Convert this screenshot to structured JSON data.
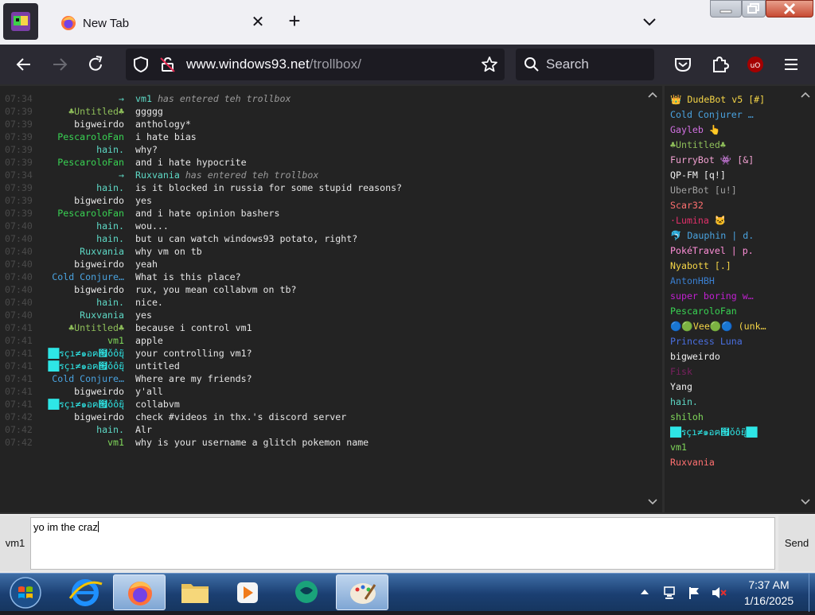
{
  "browser": {
    "tab_title": "New Tab",
    "url_host": "www.windows93.net",
    "url_path": "/trollbox/",
    "search_placeholder": "Search"
  },
  "chat": {
    "messages": [
      {
        "time": "07:34",
        "nick": "→",
        "nick_color": "#5ed9c6",
        "text": "has entered teh trollbox",
        "system_nick": "vm1"
      },
      {
        "time": "07:39",
        "nick": "♣Untitled♣",
        "nick_color": "#8fbf5a",
        "text": "ggggg"
      },
      {
        "time": "07:39",
        "nick": "bigweirdo",
        "nick_color": "#e6e6e6",
        "text": "anthology*"
      },
      {
        "time": "07:39",
        "nick": "PescaroloFan",
        "nick_color": "#39d353",
        "text": "i hate bias"
      },
      {
        "time": "07:39",
        "nick": "hain.",
        "nick_color": "#5ed9c6",
        "text": "why?"
      },
      {
        "time": "07:39",
        "nick": "PescaroloFan",
        "nick_color": "#39d353",
        "text": "and i hate hypocrite"
      },
      {
        "time": "07:34",
        "nick": "→",
        "nick_color": "#5ed9c6",
        "text": "has entered teh trollbox",
        "system_nick": "Ruxvania"
      },
      {
        "time": "07:39",
        "nick": "hain.",
        "nick_color": "#5ed9c6",
        "text": "is it blocked in russia for some stupid reasons?"
      },
      {
        "time": "07:39",
        "nick": "bigweirdo",
        "nick_color": "#e6e6e6",
        "text": "yes"
      },
      {
        "time": "07:39",
        "nick": "PescaroloFan",
        "nick_color": "#39d353",
        "text": "and i hate opinion bashers"
      },
      {
        "time": "07:40",
        "nick": "hain.",
        "nick_color": "#5ed9c6",
        "text": "wou..."
      },
      {
        "time": "07:40",
        "nick": "hain.",
        "nick_color": "#5ed9c6",
        "text": "but u can watch windows93 potato, right?"
      },
      {
        "time": "07:40",
        "nick": "Ruxvania",
        "nick_color": "#5ed9c6",
        "text": "why vm on tb"
      },
      {
        "time": "07:40",
        "nick": "bigweirdo",
        "nick_color": "#e6e6e6",
        "text": "yeah"
      },
      {
        "time": "07:40",
        "nick": "Cold Conjure…",
        "nick_color": "#4aa3e0",
        "text": "What is this place?"
      },
      {
        "time": "07:40",
        "nick": "bigweirdo",
        "nick_color": "#e6e6e6",
        "text": "rux, you mean collabvm on tb?"
      },
      {
        "time": "07:40",
        "nick": "hain.",
        "nick_color": "#5ed9c6",
        "text": "nice."
      },
      {
        "time": "07:40",
        "nick": "Ruxvania",
        "nick_color": "#5ed9c6",
        "text": "yes"
      },
      {
        "time": "07:41",
        "nick": "♣Untitled♣",
        "nick_color": "#8fbf5a",
        "text": "because i control vm1"
      },
      {
        "time": "07:41",
        "nick": "vm1",
        "nick_color": "#7fd65a",
        "text": "apple"
      },
      {
        "time": "07:41",
        "nick": "██รçı≠๑อฅ๟ǒỗยุ",
        "nick_color": "#2ee6e6",
        "text": "your controlling vm1?"
      },
      {
        "time": "07:41",
        "nick": "██รçı≠๑อฅ๟ǒỗยุ",
        "nick_color": "#2ee6e6",
        "text": "untitled"
      },
      {
        "time": "07:41",
        "nick": "Cold Conjure…",
        "nick_color": "#4aa3e0",
        "text": "Where are my friends?"
      },
      {
        "time": "07:41",
        "nick": "bigweirdo",
        "nick_color": "#e6e6e6",
        "text": "y'all"
      },
      {
        "time": "07:41",
        "nick": "██รçı≠๑อฅ๟ǒỗยุ",
        "nick_color": "#2ee6e6",
        "text": "collabvm"
      },
      {
        "time": "07:42",
        "nick": "bigweirdo",
        "nick_color": "#e6e6e6",
        "text": "check #videos in thx.'s discord server"
      },
      {
        "time": "07:42",
        "nick": "hain.",
        "nick_color": "#5ed9c6",
        "text": "Alr"
      },
      {
        "time": "07:42",
        "nick": "vm1",
        "nick_color": "#7fd65a",
        "text": "why is your username a glitch pokemon name"
      }
    ]
  },
  "userlist": [
    {
      "name": "👑 DudeBot v5 [#]",
      "color": "#f5d547"
    },
    {
      "name": "Cold Conjurer …",
      "color": "#4aa3e0"
    },
    {
      "name": "Gayleb 👆",
      "color": "#d070e0"
    },
    {
      "name": "♣Untitled♣",
      "color": "#8fbf5a"
    },
    {
      "name": "FurryBot 👾 [&]",
      "color": "#f0a0d0"
    },
    {
      "name": "QP-FM [q!]",
      "color": "#f0f0f0"
    },
    {
      "name": "UberBot [u!]",
      "color": "#a0a0a0"
    },
    {
      "name": "Scar32",
      "color": "#ff7070"
    },
    {
      "name": "·Lumina 🐱",
      "color": "#e0306a"
    },
    {
      "name": "🐬 Dauphin | d.",
      "color": "#4aa3e0"
    },
    {
      "name": "PokéTravel | p.",
      "color": "#ff8fd8"
    },
    {
      "name": "Nyabott [.]",
      "color": "#f5d547"
    },
    {
      "name": "AntonHBH",
      "color": "#3a7fd0"
    },
    {
      "name": "super boring w…",
      "color": "#c020d0"
    },
    {
      "name": "PescaroloFan",
      "color": "#39d353"
    },
    {
      "name": "🔵🟢Vee🟢🔵 (unk…",
      "color": "#f5d547"
    },
    {
      "name": "Princess Luna",
      "color": "#4a6fe0"
    },
    {
      "name": "bigweirdo",
      "color": "#f0f0f0"
    },
    {
      "name": "Fisk",
      "color": "#7a2060"
    },
    {
      "name": "Yang",
      "color": "#f0f0f0"
    },
    {
      "name": "hain.",
      "color": "#5ed9c6"
    },
    {
      "name": "shiloh",
      "color": "#7fd65a"
    },
    {
      "name": "██รçı≠๑อฅ๟ǒỗยุ██",
      "color": "#2ee6e6"
    },
    {
      "name": "vm1",
      "color": "#7fd65a"
    },
    {
      "name": "Ruxvania",
      "color": "#ff7070"
    }
  ],
  "input": {
    "nick": "vm1",
    "value": "yo im the craz",
    "send_label": "Send"
  },
  "taskbar": {
    "time": "7:37 AM",
    "date": "1/16/2025"
  }
}
